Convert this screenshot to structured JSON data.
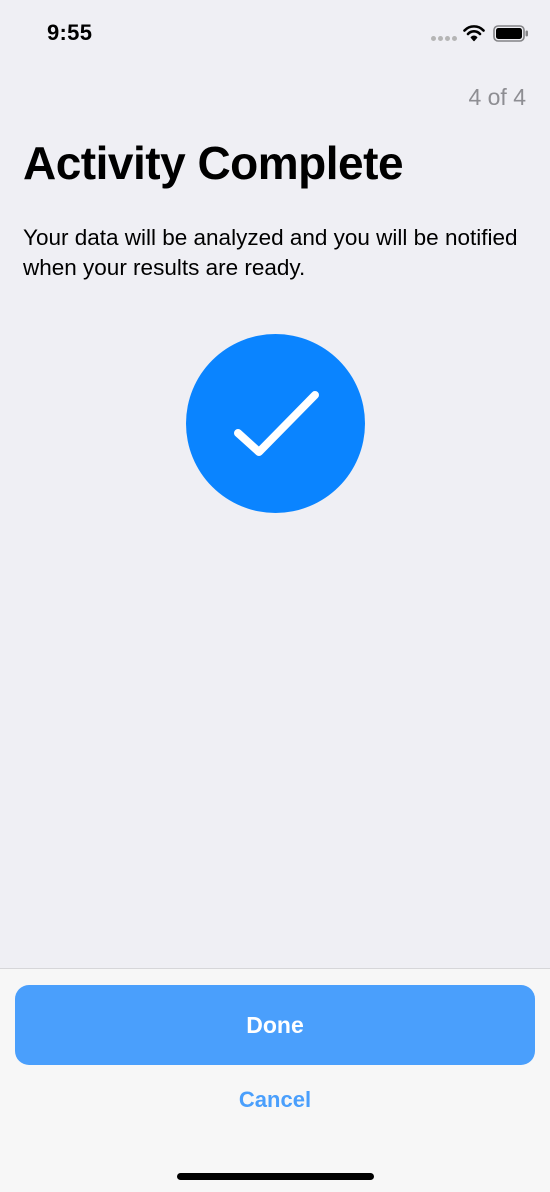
{
  "status_bar": {
    "time": "9:55",
    "icons": [
      "signal-dots-icon",
      "wifi-icon",
      "battery-icon"
    ]
  },
  "step": {
    "progress": "4 of 4",
    "title": "Activity Complete",
    "detail": "Your data will be analyzed and you will be notified when your results are ready.",
    "icon": "checkmark-icon"
  },
  "footer": {
    "done_label": "Done",
    "cancel_label": "Cancel"
  },
  "colors": {
    "background": "#efeff4",
    "accent": "#0a84ff",
    "button": "#4a9ffc",
    "secondary_text": "#8e8e93"
  }
}
